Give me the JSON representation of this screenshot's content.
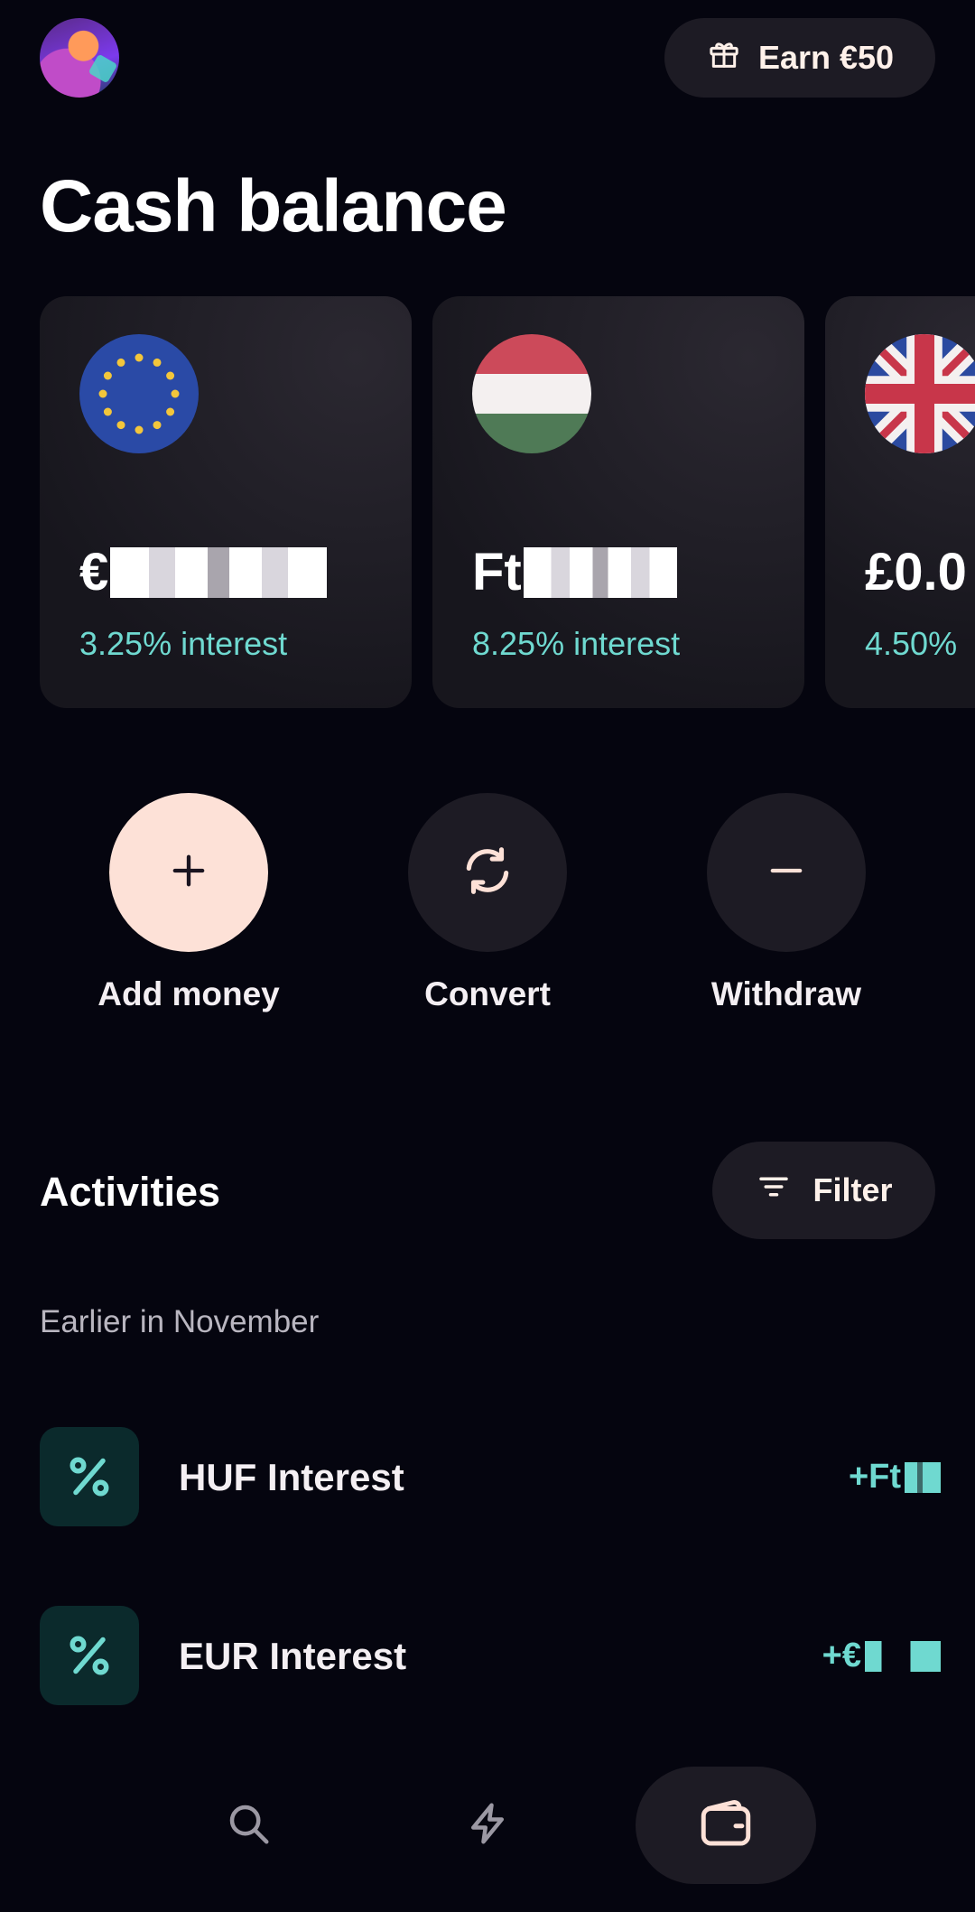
{
  "header": {
    "earn_label": "Earn €50"
  },
  "title": "Cash balance",
  "accounts": [
    {
      "flag": "eu-flag",
      "currency_symbol": "€",
      "interest": "3.25% interest"
    },
    {
      "flag": "hungary-flag",
      "currency_symbol": "Ft",
      "interest": "8.25% interest"
    },
    {
      "flag": "uk-flag",
      "currency_symbol": "£0.0",
      "interest": "4.50%"
    }
  ],
  "actions": {
    "add_money": "Add money",
    "convert": "Convert",
    "withdraw": "Withdraw"
  },
  "activities": {
    "title": "Activities",
    "filter_label": "Filter",
    "group_label": "Earlier in November",
    "items": [
      {
        "title": "HUF Interest",
        "amount_prefix": "+Ft"
      },
      {
        "title": "EUR Interest",
        "amount_prefix": "+€"
      }
    ]
  },
  "colors": {
    "background": "#05050f",
    "card": "#1d1b24",
    "accent_teal": "#6fd9d0",
    "primary_action": "#fde1d7"
  }
}
